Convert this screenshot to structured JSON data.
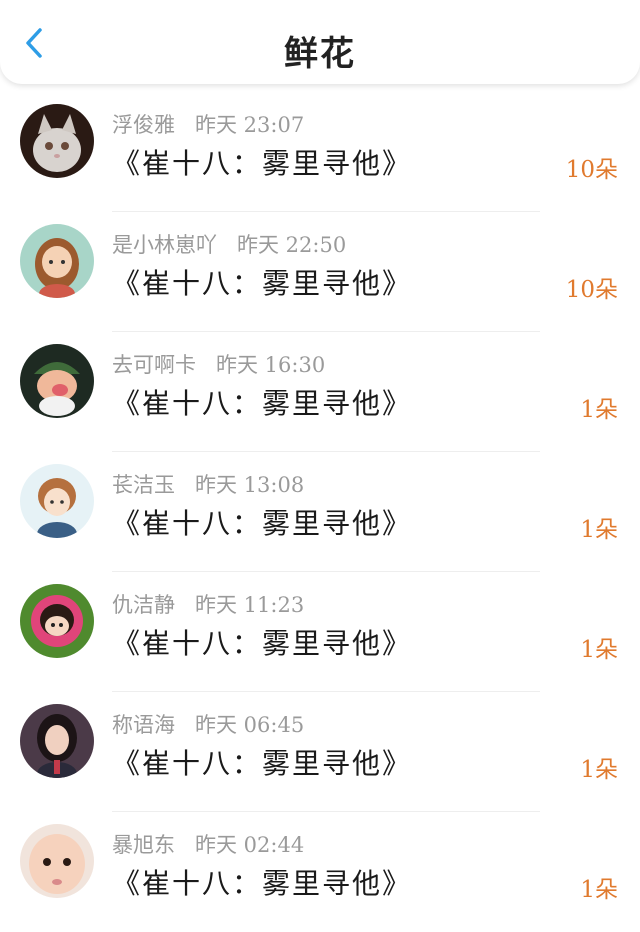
{
  "header": {
    "title": "鲜花",
    "back_icon": "chevron-left-icon",
    "accent": "#2e9de6"
  },
  "colors": {
    "count": "#e07a2e",
    "meta": "#9a9a9a"
  },
  "items": [
    {
      "user": "浮俊雅",
      "time": "昨天 23:07",
      "book": "《崔十八：雾里寻他》",
      "count": "10朵",
      "avatar": "cat-avatar"
    },
    {
      "user": "是小林崽吖",
      "time": "昨天 22:50",
      "book": "《崔十八：雾里寻他》",
      "count": "10朵",
      "avatar": "cartoon-girl-avatar"
    },
    {
      "user": "去可啊卡",
      "time": "昨天 16:30",
      "book": "《崔十八：雾里寻他》",
      "count": "1朵",
      "avatar": "cartoon-dwarf-avatar"
    },
    {
      "user": "苌洁玉",
      "time": "昨天 13:08",
      "book": "《崔十八：雾里寻他》",
      "count": "1朵",
      "avatar": "anime-boy-avatar"
    },
    {
      "user": "仇洁静",
      "time": "昨天 11:23",
      "book": "《崔十八：雾里寻他》",
      "count": "1朵",
      "avatar": "cartoon-doll-avatar"
    },
    {
      "user": "称语海",
      "time": "昨天 06:45",
      "book": "《崔十八：雾里寻他》",
      "count": "1朵",
      "avatar": "girl-photo-avatar"
    },
    {
      "user": "暴旭东",
      "time": "昨天 02:44",
      "book": "《崔十八：雾里寻他》",
      "count": "1朵",
      "avatar": "baby-photo-avatar"
    }
  ]
}
